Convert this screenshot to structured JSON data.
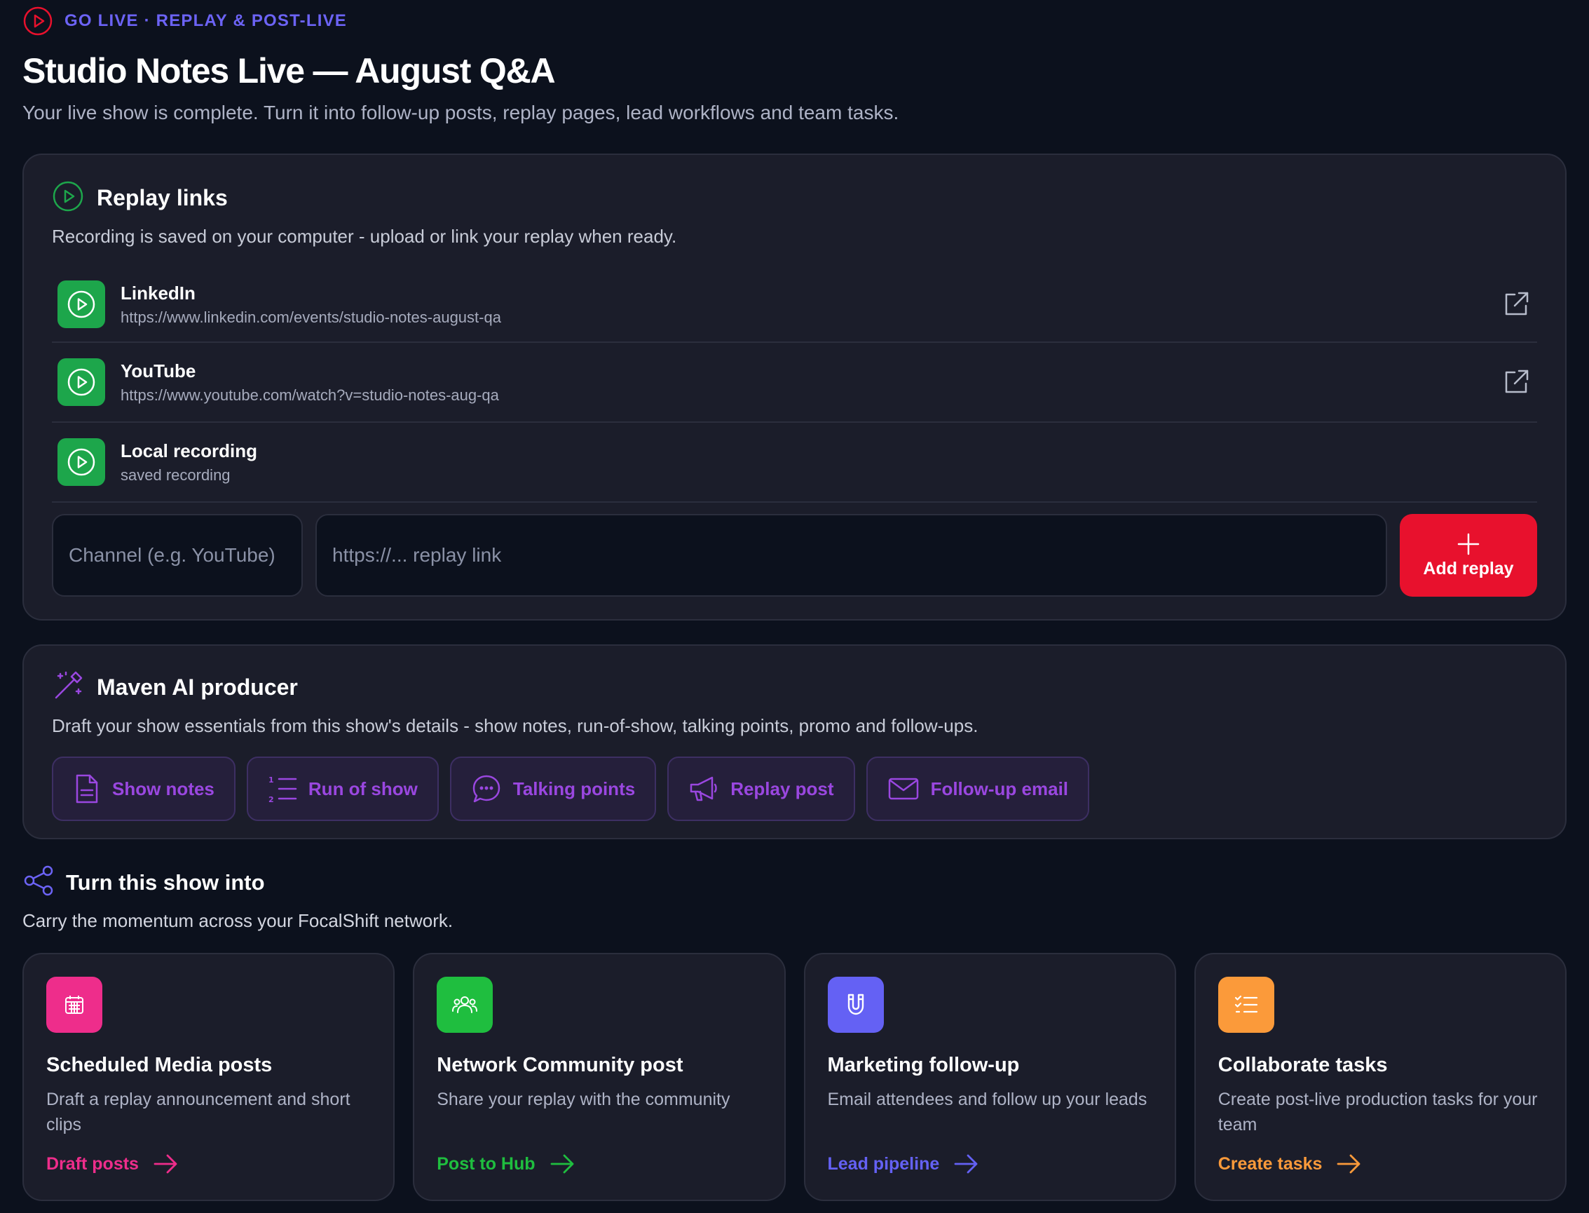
{
  "header": {
    "eyebrow": "GO LIVE · REPLAY & POST-LIVE",
    "title": "Studio Notes Live — August Q&A",
    "subtitle": "Your live show is complete. Turn it into follow-up posts, replay pages, lead workflows and team tasks."
  },
  "replay": {
    "title": "Replay links",
    "description": "Recording is saved on your computer - upload or link your replay when ready.",
    "items": [
      {
        "name": "LinkedIn",
        "url": "https://www.linkedin.com/events/studio-notes-august-qa"
      },
      {
        "name": "YouTube",
        "url": "https://www.youtube.com/watch?v=studio-notes-aug-qa"
      },
      {
        "name": "Local recording",
        "url": "saved recording"
      }
    ],
    "channel_placeholder": "Channel (e.g. YouTube)",
    "url_placeholder": "https://... replay link",
    "add_label": "Add replay"
  },
  "maven": {
    "title": "Maven AI producer",
    "description": "Draft your show essentials from this show's details - show notes, run-of-show, talking points, promo and follow-ups.",
    "chips": [
      "Show notes",
      "Run of show",
      "Talking points",
      "Replay post",
      "Follow-up email"
    ]
  },
  "turn": {
    "title": "Turn this show into",
    "description": "Carry the momentum across your FocalShift network."
  },
  "cards": [
    {
      "title": "Scheduled Media posts",
      "desc": "Draft a replay announcement and short clips",
      "action": "Draft posts",
      "color": "#ee2d8b",
      "icon": "calendar-icon"
    },
    {
      "title": "Network Community post",
      "desc": "Share your replay with the community",
      "action": "Post to Hub",
      "color": "#1fbe3f",
      "icon": "users-icon"
    },
    {
      "title": "Marketing follow-up",
      "desc": "Email attendees and follow up your leads",
      "action": "Lead pipeline",
      "color": "#6461f4",
      "icon": "magnet-icon"
    },
    {
      "title": "Collaborate tasks",
      "desc": "Create post-live production tasks for your team",
      "action": "Create tasks",
      "color": "#fb9a3a",
      "icon": "checklist-icon"
    }
  ],
  "colors": {
    "background": "#0c111d",
    "panel": "#1b1d2a",
    "accent_indigo": "#6c63f5",
    "live_red": "#e8112d",
    "replay_green": "#1da64b",
    "ai_purple": "#9a47e0"
  }
}
